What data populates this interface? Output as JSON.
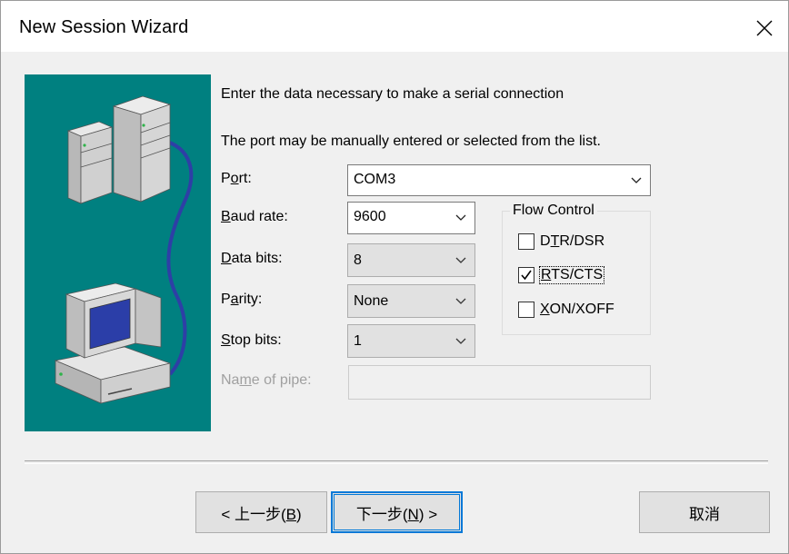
{
  "window": {
    "title": "New Session Wizard",
    "close_icon": "close-icon"
  },
  "intro": {
    "line1": "Enter the data necessary to make a serial connection",
    "line2": "The port may be manually entered or selected from the list."
  },
  "form": {
    "port": {
      "label_pre": "P",
      "label_acc": "o",
      "label_post": "rt:",
      "value": "COM3"
    },
    "baud_rate": {
      "label_pre": "",
      "label_acc": "B",
      "label_post": "aud rate:",
      "value": "9600"
    },
    "data_bits": {
      "label_pre": "",
      "label_acc": "D",
      "label_post": "ata bits:",
      "value": "8"
    },
    "parity": {
      "label_pre": "P",
      "label_acc": "a",
      "label_post": "rity:",
      "value": "None"
    },
    "stop_bits": {
      "label_pre": "",
      "label_acc": "S",
      "label_post": "top bits:",
      "value": "1"
    },
    "name_of_pipe": {
      "label_pre": "Na",
      "label_acc": "m",
      "label_post": "e of pipe:",
      "value": ""
    }
  },
  "flow_control": {
    "title": "Flow Control",
    "dtr_dsr": {
      "label_pre": "D",
      "label_acc": "T",
      "label_post": "R/DSR",
      "checked": false
    },
    "rts_cts": {
      "label_pre": "",
      "label_acc": "R",
      "label_post": "TS/CTS",
      "checked": true
    },
    "xon_xoff": {
      "label_pre": "",
      "label_acc": "X",
      "label_post": "ON/XOFF",
      "checked": false
    }
  },
  "buttons": {
    "back_pre": "< 上一步(",
    "back_acc": "B",
    "back_post": ")",
    "next_pre": "下一步(",
    "next_acc": "N",
    "next_post": ") >",
    "cancel": "取消"
  },
  "colors": {
    "illustration_bg": "#008080",
    "focus_border": "#0078d7",
    "monitor_screen": "#2b3ea8",
    "cable": "#2e3fa6"
  }
}
